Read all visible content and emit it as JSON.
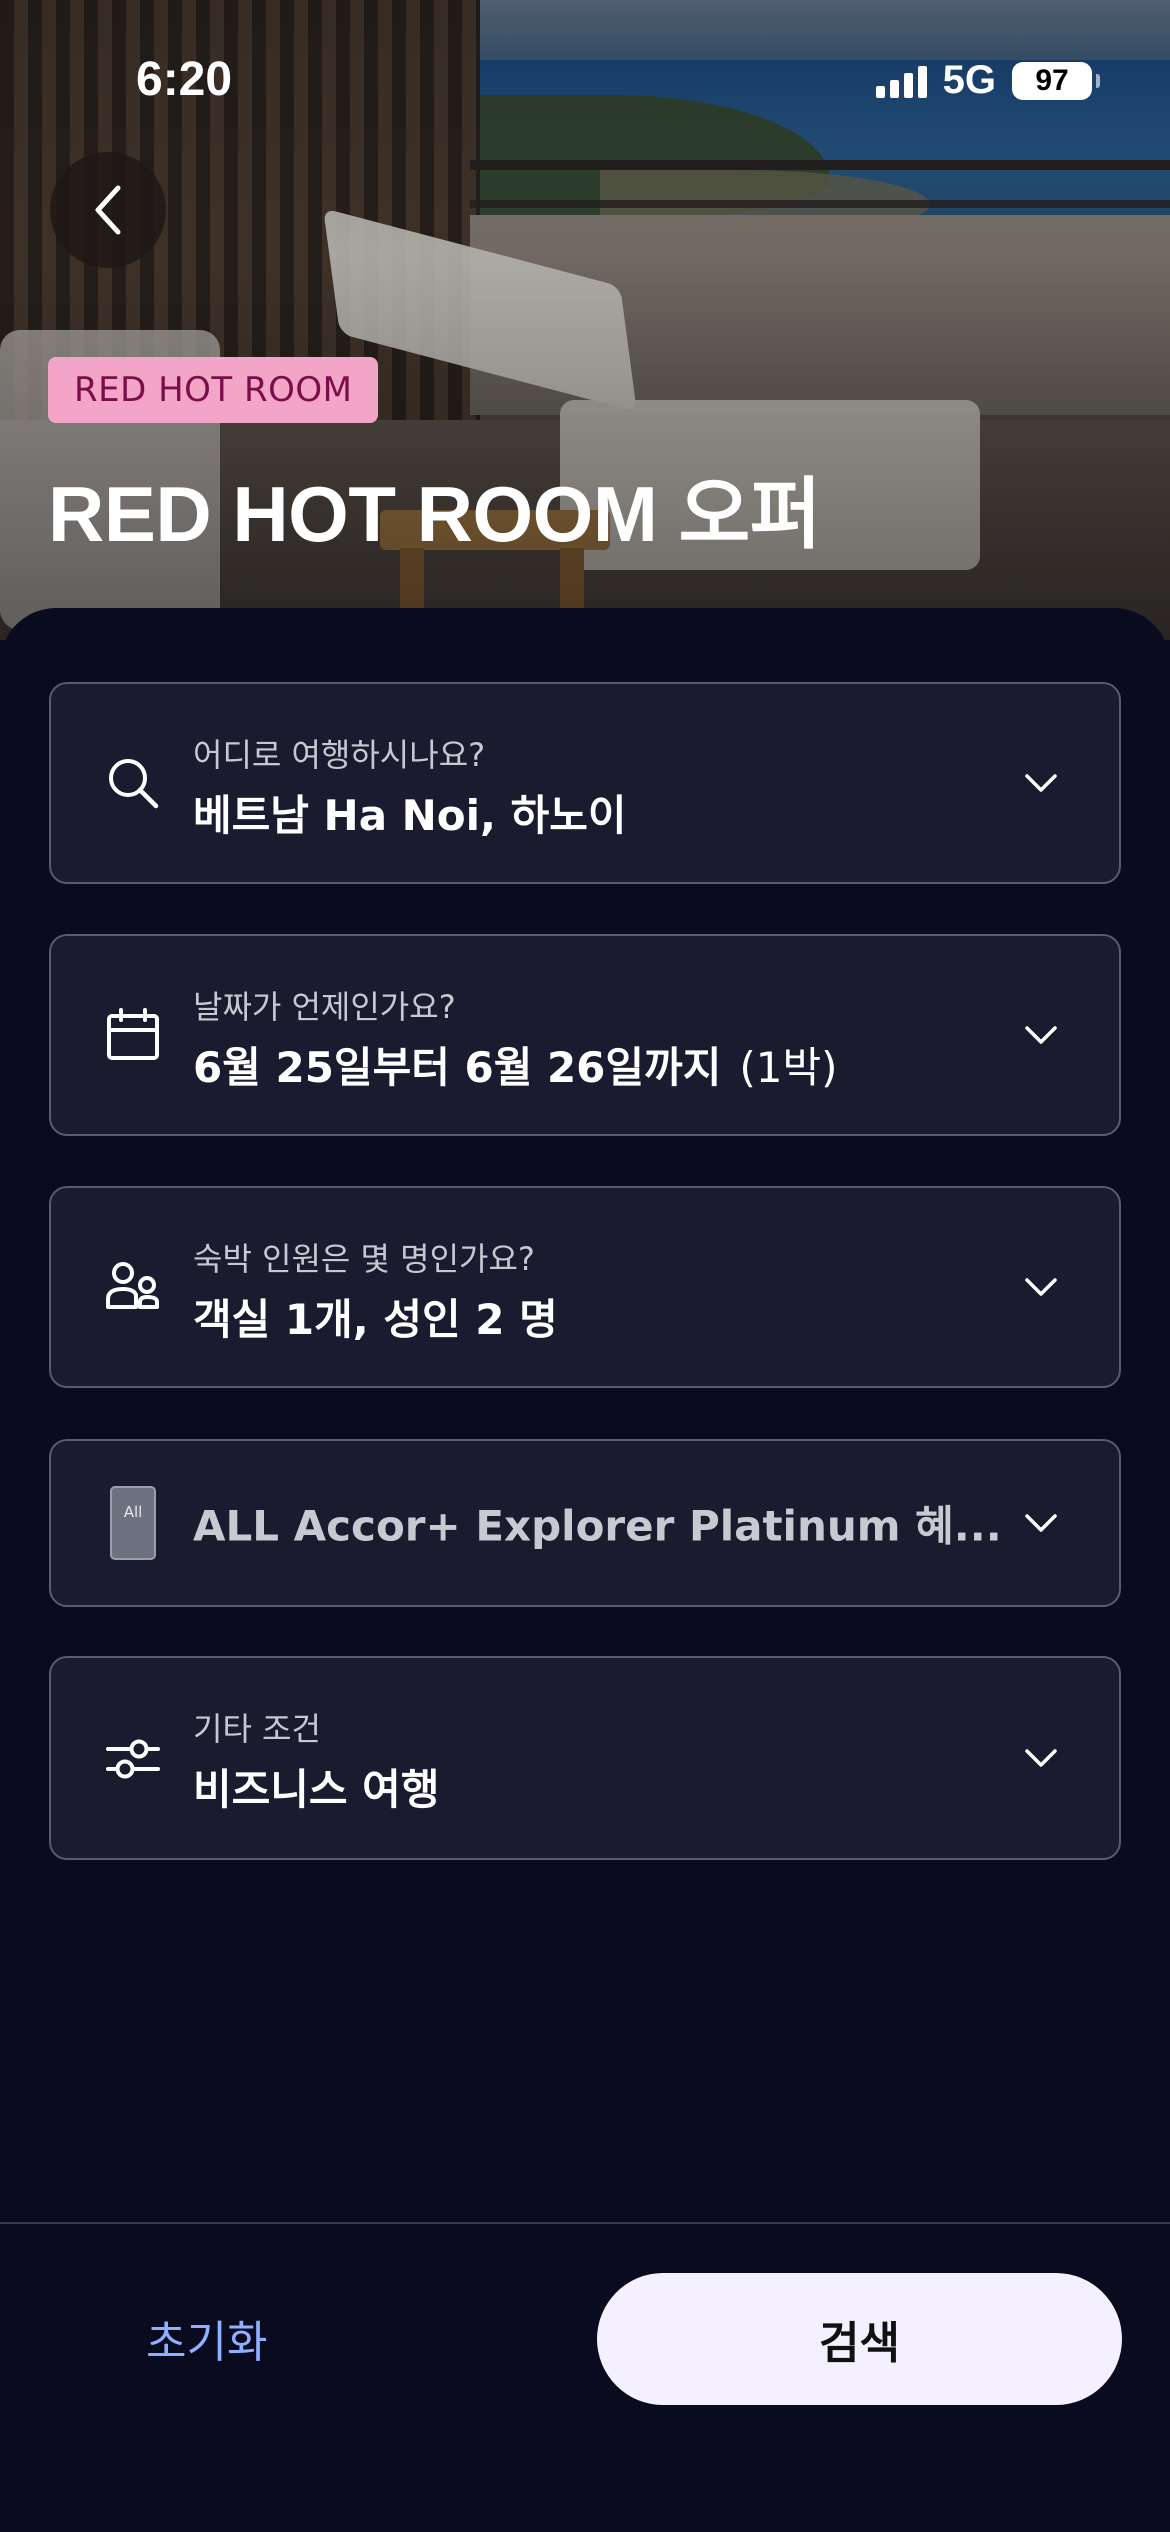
{
  "status_bar": {
    "time": "6:20",
    "network": "5G",
    "battery": "97"
  },
  "hero": {
    "tag": "RED HOT ROOM",
    "title": "RED HOT ROOM 오퍼"
  },
  "fields": {
    "destination": {
      "label": "어디로 여행하시나요?",
      "value": "베트남 Ha Noi, 하노이",
      "icon": "search-icon"
    },
    "dates": {
      "label": "날짜가 언제인가요?",
      "value": "6월 25일부터 6월 26일까지",
      "nights": "(1박)",
      "icon": "calendar-icon"
    },
    "guests": {
      "label": "숙박 인원은 몇 명인가요?",
      "value": "객실 1개, 성인 2 명",
      "icon": "people-icon"
    },
    "membership": {
      "value": "ALL Accor+ Explorer Platinum 혜...",
      "card_text": "All",
      "icon": "membership-card-icon"
    },
    "filters": {
      "label": "기타 조건",
      "value": "비즈니스 여행",
      "icon": "sliders-icon"
    }
  },
  "footer": {
    "reset_label": "초기화",
    "search_label": "검색"
  },
  "colors": {
    "background": "#0b0b1f",
    "field_bg": "#1b1b2f",
    "tag_bg": "#f3a5c8",
    "reset_text": "#8fb0ff",
    "search_bg": "#f4f0ff"
  }
}
